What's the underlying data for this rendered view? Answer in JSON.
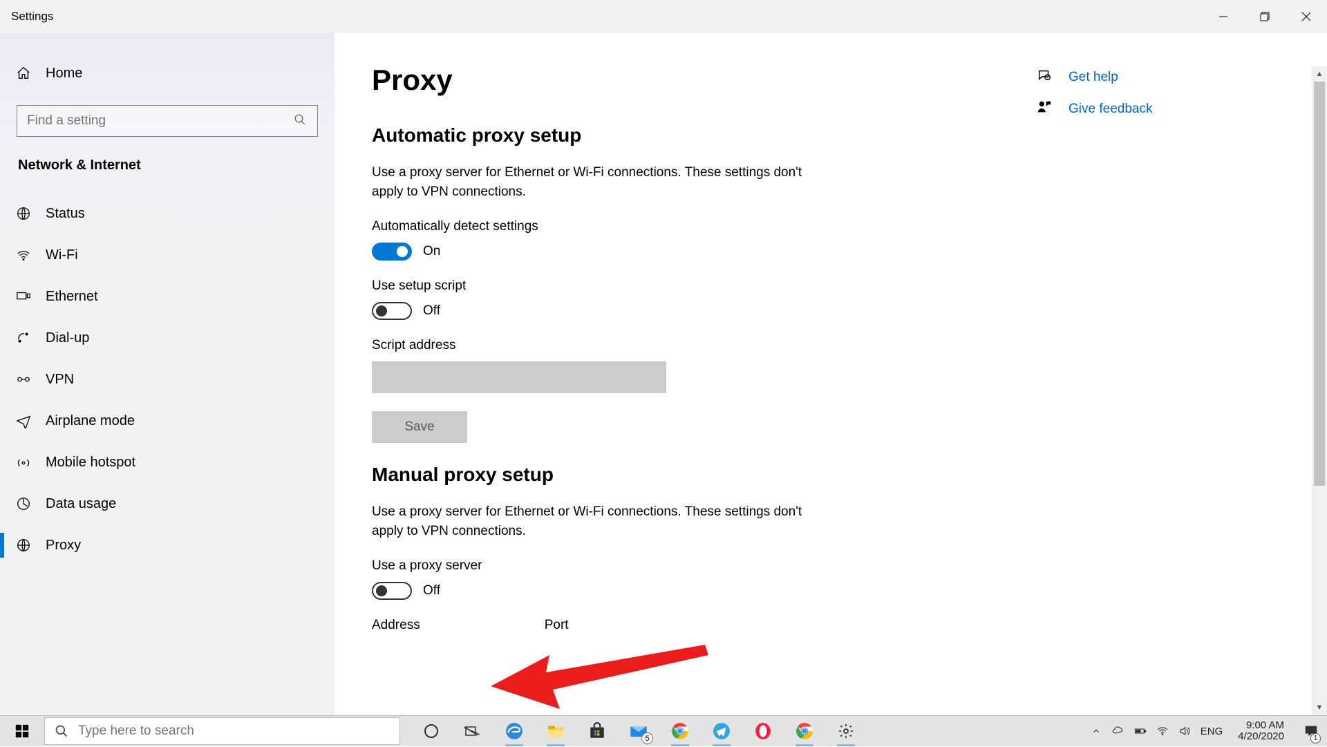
{
  "window": {
    "title": "Settings"
  },
  "sidebar": {
    "home_label": "Home",
    "search_placeholder": "Find a setting",
    "section_title": "Network & Internet",
    "items": [
      {
        "label": "Status"
      },
      {
        "label": "Wi-Fi"
      },
      {
        "label": "Ethernet"
      },
      {
        "label": "Dial-up"
      },
      {
        "label": "VPN"
      },
      {
        "label": "Airplane mode"
      },
      {
        "label": "Mobile hotspot"
      },
      {
        "label": "Data usage"
      },
      {
        "label": "Proxy"
      }
    ]
  },
  "main": {
    "page_title": "Proxy",
    "auto": {
      "section_title": "Automatic proxy setup",
      "desc": "Use a proxy server for Ethernet or Wi-Fi connections. These settings don't apply to VPN connections.",
      "detect_label": "Automatically detect settings",
      "detect_state": "On",
      "script_label": "Use setup script",
      "script_state": "Off",
      "script_address_label": "Script address",
      "script_address_value": "",
      "save_label": "Save"
    },
    "manual": {
      "section_title": "Manual proxy setup",
      "desc": "Use a proxy server for Ethernet or Wi-Fi connections. These settings don't apply to VPN connections.",
      "use_label": "Use a proxy server",
      "use_state": "Off",
      "address_label": "Address",
      "port_label": "Port"
    }
  },
  "side": {
    "help_label": "Get help",
    "feedback_label": "Give feedback"
  },
  "taskbar": {
    "search_placeholder": "Type here to search",
    "lang": "ENG",
    "time": "9:00 AM",
    "date": "4/20/2020",
    "mail_badge": "5",
    "notif_badge": "1"
  }
}
